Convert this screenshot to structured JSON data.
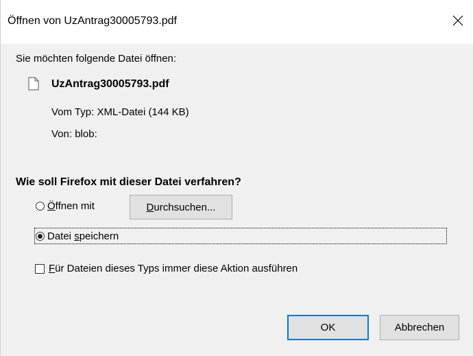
{
  "dialog": {
    "title": "Öffnen von UzAntrag30005793.pdf",
    "intro": "Sie möchten folgende Datei öffnen:",
    "file_name": "UzAntrag30005793.pdf",
    "type_label": "Vom Typ:",
    "type_value": "XML-Datei (144 KB)",
    "from_label": "Von:",
    "from_value": "blob:",
    "question": "Wie soll Firefox mit dieser Datei verfahren?"
  },
  "options": {
    "open_with": {
      "access_key": "Ö",
      "rest": "ffnen mit",
      "selected": false
    },
    "browse": {
      "access_key": "D",
      "rest": "urchsuchen..."
    },
    "save_file": {
      "before": "Datei ",
      "access_key": "s",
      "rest": "peichern",
      "selected": true
    }
  },
  "always": {
    "access_key": "F",
    "rest": "ür Dateien dieses Typs immer diese Aktion ausführen",
    "checked": false
  },
  "buttons": {
    "ok": "OK",
    "cancel": "Abbrechen"
  },
  "colors": {
    "dialog_bg": "#f0f0f0",
    "titlebar_bg": "#ffffff",
    "default_button_border": "#0078d7"
  },
  "icons": {
    "close": "close-icon",
    "file": "file-icon"
  }
}
